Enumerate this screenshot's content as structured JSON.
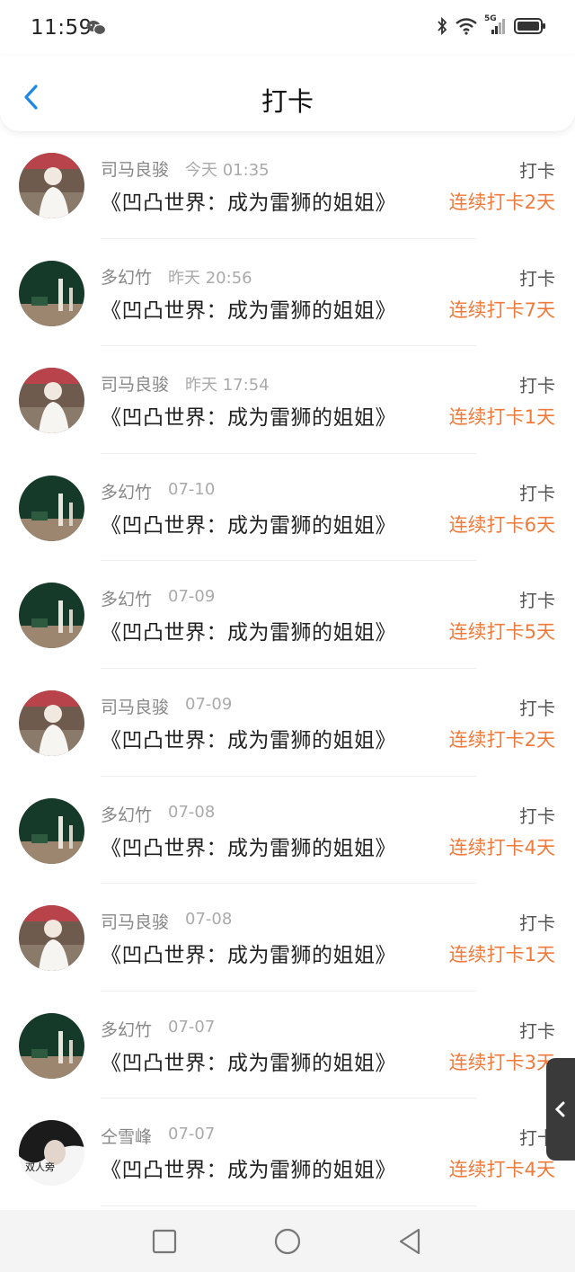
{
  "status_bar": {
    "time": "11:59",
    "network": "5G"
  },
  "header": {
    "title": "打卡"
  },
  "items": [
    {
      "user": "司马良骏",
      "time": "今天 01:35",
      "book": "《凹凸世界：成为雷狮的姐姐》",
      "type": "打卡",
      "streak": "连续打卡2天",
      "avatar": "a"
    },
    {
      "user": "多幻竹",
      "time": "昨天 20:56",
      "book": "《凹凸世界：成为雷狮的姐姐》",
      "type": "打卡",
      "streak": "连续打卡7天",
      "avatar": "b"
    },
    {
      "user": "司马良骏",
      "time": "昨天 17:54",
      "book": "《凹凸世界：成为雷狮的姐姐》",
      "type": "打卡",
      "streak": "连续打卡1天",
      "avatar": "a"
    },
    {
      "user": "多幻竹",
      "time": "07-10",
      "book": "《凹凸世界：成为雷狮的姐姐》",
      "type": "打卡",
      "streak": "连续打卡6天",
      "avatar": "b"
    },
    {
      "user": "多幻竹",
      "time": "07-09",
      "book": "《凹凸世界：成为雷狮的姐姐》",
      "type": "打卡",
      "streak": "连续打卡5天",
      "avatar": "b"
    },
    {
      "user": "司马良骏",
      "time": "07-09",
      "book": "《凹凸世界：成为雷狮的姐姐》",
      "type": "打卡",
      "streak": "连续打卡2天",
      "avatar": "a"
    },
    {
      "user": "多幻竹",
      "time": "07-08",
      "book": "《凹凸世界：成为雷狮的姐姐》",
      "type": "打卡",
      "streak": "连续打卡4天",
      "avatar": "b"
    },
    {
      "user": "司马良骏",
      "time": "07-08",
      "book": "《凹凸世界：成为雷狮的姐姐》",
      "type": "打卡",
      "streak": "连续打卡1天",
      "avatar": "a"
    },
    {
      "user": "多幻竹",
      "time": "07-07",
      "book": "《凹凸世界：成为雷狮的姐姐》",
      "type": "打卡",
      "streak": "连续打卡3天",
      "avatar": "b"
    },
    {
      "user": "仝雪峰",
      "time": "07-07",
      "book": "《凹凸世界：成为雷狮的姐姐》",
      "type": "打卡",
      "streak": "连续打卡4天",
      "avatar": "c",
      "avatar_text": "双人旁"
    }
  ],
  "colors": {
    "accent": "#1e88e5",
    "streak": "#f07a3a"
  }
}
